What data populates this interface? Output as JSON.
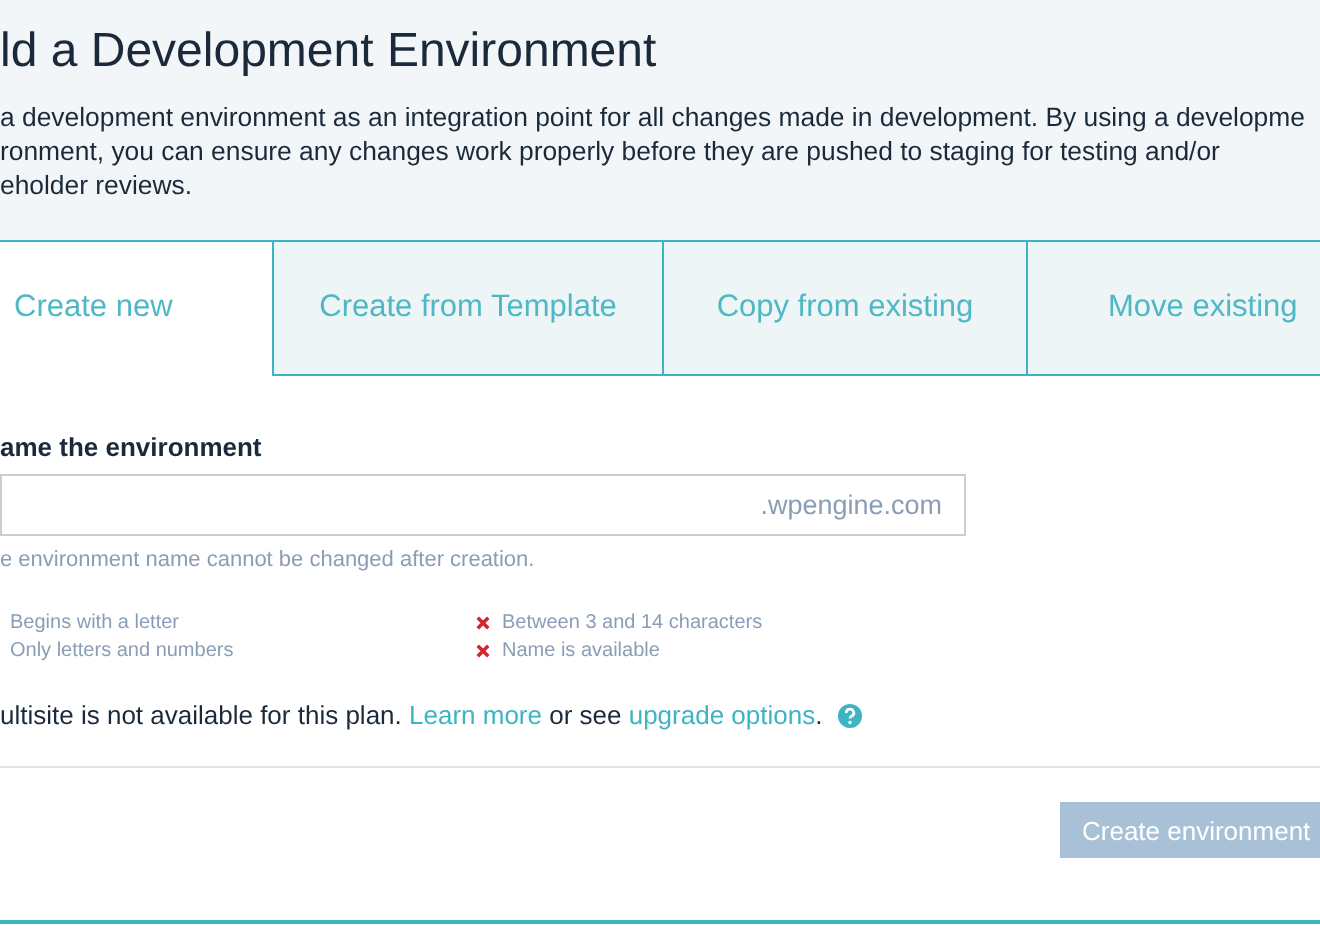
{
  "header": {
    "title": "ld a Development Environment",
    "description": "a development environment as an integration point for all changes made in development. By using a developme\nronment, you can ensure any changes work properly before they are pushed to staging for testing and/or\neholder reviews."
  },
  "tabs": [
    {
      "label": "Create new",
      "selected": true
    },
    {
      "label": "Create from Template",
      "selected": false
    },
    {
      "label": "Copy from existing",
      "selected": false
    },
    {
      "label": "Move existing",
      "selected": false
    }
  ],
  "form": {
    "label": "ame the environment",
    "suffix": ".wpengine.com",
    "hint": "e environment name cannot be changed after creation.",
    "criteria": [
      {
        "text": "Begins with a letter",
        "failed": false
      },
      {
        "text": "Only letters and numbers",
        "failed": false
      },
      {
        "text": "Between 3 and 14 characters",
        "failed": true
      },
      {
        "text": "Name is available",
        "failed": true
      }
    ],
    "notice": {
      "text": "ultisite is not available for this plan.",
      "link1": "Learn more",
      "middle": "or see",
      "link2": "upgrade options",
      "end": "."
    }
  },
  "footer": {
    "button": {
      "label": "Create environment",
      "disabled": true
    }
  }
}
